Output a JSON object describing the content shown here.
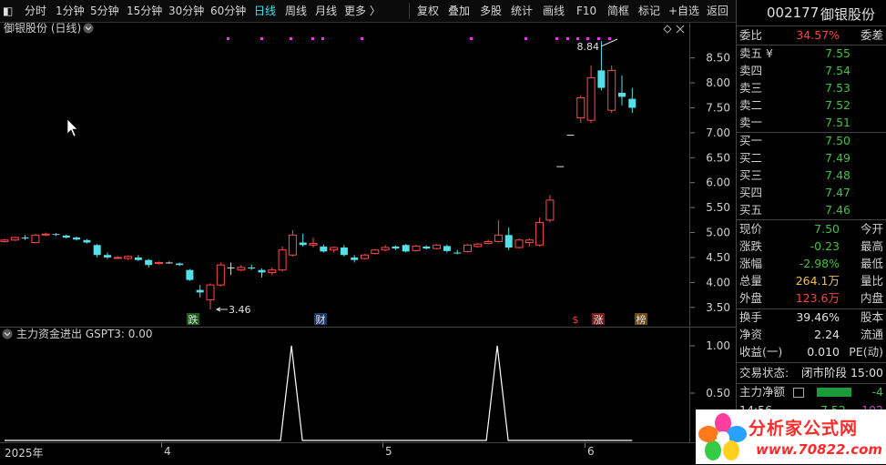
{
  "toolbar": {
    "periods": [
      "分时",
      "1分钟",
      "5分钟",
      "15分钟",
      "30分钟",
      "60分钟",
      "日线",
      "周线",
      "月线",
      "更多 〉"
    ],
    "active_period": "日线",
    "tools": [
      "复权",
      "叠加",
      "多股",
      "统计",
      "画线",
      "F10",
      "简框",
      "标记",
      "+自选",
      "返回"
    ]
  },
  "stock": {
    "code": "002177",
    "name": "御银股份"
  },
  "main_chart": {
    "title": "御银股份 (日线)",
    "high_label": "8.84",
    "low_label": "3.46",
    "badges": [
      "跌",
      "财",
      "$",
      "涨",
      "榜"
    ]
  },
  "sub_chart": {
    "title": "主力资金进出 GSPT3: 0.00"
  },
  "order_book": {
    "weibi": {
      "label": "委比",
      "value": "34.57%",
      "label2": "委差"
    },
    "asks": [
      {
        "label": "卖五 ¥",
        "price": "7.55"
      },
      {
        "label": "卖四",
        "price": "7.54"
      },
      {
        "label": "卖三",
        "price": "7.53"
      },
      {
        "label": "卖二",
        "price": "7.52"
      },
      {
        "label": "卖一",
        "price": "7.51"
      }
    ],
    "bids": [
      {
        "label": "买一",
        "price": "7.50"
      },
      {
        "label": "买二",
        "price": "7.49"
      },
      {
        "label": "买三",
        "price": "7.48"
      },
      {
        "label": "买四",
        "price": "7.47"
      },
      {
        "label": "买五",
        "price": "7.46"
      }
    ]
  },
  "quote": [
    {
      "label": "现价",
      "value": "7.50",
      "label2": "今开",
      "color": "#3cc43c"
    },
    {
      "label": "涨跌",
      "value": "-0.23",
      "label2": "最高",
      "color": "#3cc43c"
    },
    {
      "label": "涨幅",
      "value": "-2.98%",
      "label2": "最低",
      "color": "#3cc43c"
    },
    {
      "label": "总量",
      "value": "264.1万",
      "label2": "量比",
      "color": "#f0c040"
    },
    {
      "label": "外盘",
      "value": "123.6万",
      "label2": "内盘",
      "color": "#ff4040"
    }
  ],
  "stats": [
    {
      "label": "换手",
      "value": "39.46%",
      "label2": "股本"
    },
    {
      "label": "净资",
      "value": "2.24",
      "label2": "流通"
    },
    {
      "label": "收益(一)",
      "value": "0.010",
      "label2": "PE(动)"
    }
  ],
  "status": {
    "label": "交易状态:",
    "value": "闭市阶段 15:00"
  },
  "flow": {
    "label": "主力净额",
    "value": "-4"
  },
  "tick": {
    "time": "14:56",
    "price": "7.52",
    "vol": "102"
  },
  "watermark": {
    "title": "分析家公式网",
    "url": "www.70822.com"
  },
  "chart_data": [
    {
      "type": "candlestick",
      "title": "御银股份 (日线)",
      "x_labels": [
        "2025年",
        "4",
        "5",
        "6"
      ],
      "ylim": [
        3.25,
        9.0
      ],
      "y_ticks": [
        3.5,
        4.0,
        4.5,
        5.0,
        5.5,
        6.0,
        6.5,
        7.0,
        7.5,
        8.0,
        8.5
      ],
      "annotations": [
        {
          "text": "8.84",
          "kind": "max"
        },
        {
          "text": "3.46",
          "kind": "min"
        }
      ],
      "candles": [
        {
          "o": 4.82,
          "c": 4.85,
          "h": 4.87,
          "l": 4.8
        },
        {
          "o": 4.85,
          "c": 4.9,
          "h": 4.92,
          "l": 4.83
        },
        {
          "o": 4.9,
          "c": 4.88,
          "h": 4.95,
          "l": 4.85
        },
        {
          "o": 4.8,
          "c": 4.95,
          "h": 4.97,
          "l": 4.78
        },
        {
          "o": 4.95,
          "c": 4.97,
          "h": 5.0,
          "l": 4.93
        },
        {
          "o": 4.97,
          "c": 4.96,
          "h": 4.99,
          "l": 4.93
        },
        {
          "o": 4.94,
          "c": 4.9,
          "h": 4.96,
          "l": 4.88
        },
        {
          "o": 4.9,
          "c": 4.86,
          "h": 4.92,
          "l": 4.84
        },
        {
          "o": 4.85,
          "c": 4.8,
          "h": 4.87,
          "l": 4.78
        },
        {
          "o": 4.75,
          "c": 4.55,
          "h": 4.77,
          "l": 4.5
        },
        {
          "o": 4.55,
          "c": 4.5,
          "h": 4.6,
          "l": 4.47
        },
        {
          "o": 4.49,
          "c": 4.5,
          "h": 4.53,
          "l": 4.47
        },
        {
          "o": 4.48,
          "c": 4.52,
          "h": 4.54,
          "l": 4.45
        },
        {
          "o": 4.5,
          "c": 4.45,
          "h": 4.55,
          "l": 4.43
        },
        {
          "o": 4.45,
          "c": 4.35,
          "h": 4.47,
          "l": 4.3
        },
        {
          "o": 4.38,
          "c": 4.4,
          "h": 4.42,
          "l": 4.36
        },
        {
          "o": 4.4,
          "c": 4.4,
          "h": 4.42,
          "l": 4.38
        },
        {
          "o": 4.38,
          "c": 4.35,
          "h": 4.4,
          "l": 4.33
        },
        {
          "o": 4.25,
          "c": 4.05,
          "h": 4.27,
          "l": 4.03
        },
        {
          "o": 3.85,
          "c": 3.8,
          "h": 3.95,
          "l": 3.7
        },
        {
          "o": 3.65,
          "c": 3.95,
          "h": 3.98,
          "l": 3.46
        },
        {
          "o": 3.95,
          "c": 4.35,
          "h": 4.4,
          "l": 3.92
        },
        {
          "o": 4.3,
          "c": 4.3,
          "h": 4.4,
          "l": 4.15
        },
        {
          "o": 4.25,
          "c": 4.3,
          "h": 4.35,
          "l": 4.22
        },
        {
          "o": 4.3,
          "c": 4.28,
          "h": 4.36,
          "l": 4.25
        },
        {
          "o": 4.25,
          "c": 4.2,
          "h": 4.28,
          "l": 4.1
        },
        {
          "o": 4.2,
          "c": 4.25,
          "h": 4.3,
          "l": 4.15
        },
        {
          "o": 4.25,
          "c": 4.65,
          "h": 4.72,
          "l": 4.22
        },
        {
          "o": 4.55,
          "c": 4.95,
          "h": 5.05,
          "l": 4.52
        },
        {
          "o": 4.8,
          "c": 4.75,
          "h": 4.98,
          "l": 4.72
        },
        {
          "o": 4.75,
          "c": 4.78,
          "h": 4.9,
          "l": 4.7
        },
        {
          "o": 4.72,
          "c": 4.62,
          "h": 4.76,
          "l": 4.6
        },
        {
          "o": 4.65,
          "c": 4.7,
          "h": 4.72,
          "l": 4.6
        },
        {
          "o": 4.7,
          "c": 4.55,
          "h": 4.75,
          "l": 4.52
        },
        {
          "o": 4.5,
          "c": 4.45,
          "h": 4.55,
          "l": 4.4
        },
        {
          "o": 4.48,
          "c": 4.55,
          "h": 4.57,
          "l": 4.46
        },
        {
          "o": 4.58,
          "c": 4.65,
          "h": 4.67,
          "l": 4.56
        },
        {
          "o": 4.65,
          "c": 4.7,
          "h": 4.75,
          "l": 4.63
        },
        {
          "o": 4.72,
          "c": 4.68,
          "h": 4.74,
          "l": 4.65
        },
        {
          "o": 4.75,
          "c": 4.62,
          "h": 4.77,
          "l": 4.6
        },
        {
          "o": 4.64,
          "c": 4.73,
          "h": 4.75,
          "l": 4.62
        },
        {
          "o": 4.72,
          "c": 4.68,
          "h": 4.74,
          "l": 4.66
        },
        {
          "o": 4.68,
          "c": 4.75,
          "h": 4.77,
          "l": 4.66
        },
        {
          "o": 4.73,
          "c": 4.63,
          "h": 4.76,
          "l": 4.6
        },
        {
          "o": 4.6,
          "c": 4.58,
          "h": 4.65,
          "l": 4.56
        },
        {
          "o": 4.62,
          "c": 4.75,
          "h": 4.77,
          "l": 4.6
        },
        {
          "o": 4.72,
          "c": 4.77,
          "h": 4.79,
          "l": 4.7
        },
        {
          "o": 4.78,
          "c": 4.82,
          "h": 4.86,
          "l": 4.76
        },
        {
          "o": 4.82,
          "c": 4.95,
          "h": 5.25,
          "l": 4.8
        },
        {
          "o": 4.95,
          "c": 4.7,
          "h": 5.1,
          "l": 4.65
        },
        {
          "o": 4.7,
          "c": 4.85,
          "h": 4.88,
          "l": 4.68
        },
        {
          "o": 4.8,
          "c": 4.85,
          "h": 4.88,
          "l": 4.72
        },
        {
          "o": 4.75,
          "c": 5.2,
          "h": 5.3,
          "l": 4.72
        },
        {
          "o": 5.25,
          "c": 5.65,
          "h": 5.75,
          "l": 5.2
        },
        {
          "o": 6.33,
          "c": 6.33,
          "h": 6.33,
          "l": 6.33
        },
        {
          "o": 6.96,
          "c": 6.96,
          "h": 6.96,
          "l": 6.96
        },
        {
          "o": 7.3,
          "c": 7.7,
          "h": 7.75,
          "l": 7.2
        },
        {
          "o": 7.25,
          "c": 8.1,
          "h": 8.35,
          "l": 7.2
        },
        {
          "o": 8.25,
          "c": 7.9,
          "h": 8.84,
          "l": 7.85
        },
        {
          "o": 7.45,
          "c": 8.25,
          "h": 8.35,
          "l": 7.4
        },
        {
          "o": 7.8,
          "c": 7.72,
          "h": 8.15,
          "l": 7.55
        },
        {
          "o": 7.68,
          "c": 7.5,
          "h": 7.9,
          "l": 7.4
        }
      ]
    },
    {
      "type": "line",
      "title": "主力资金进出 GSPT3: 0.00",
      "series": [
        {
          "name": "GSPT3",
          "last": 0.0
        }
      ],
      "ylim": [
        0,
        1.0
      ],
      "y_ticks": [
        0.0,
        0.5,
        1.0
      ],
      "spikes": [
        {
          "x_index": 27,
          "value": 1.0
        },
        {
          "x_index": 47,
          "value": 1.0
        }
      ]
    }
  ]
}
